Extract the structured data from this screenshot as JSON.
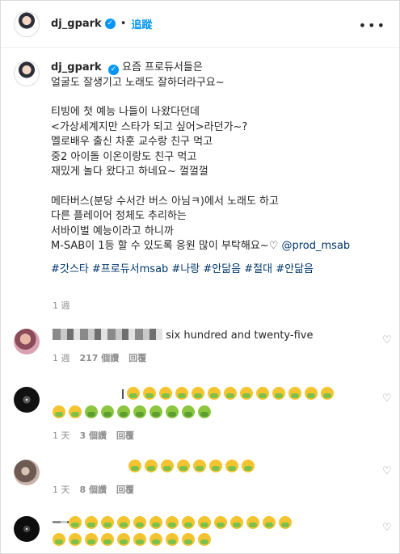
{
  "header": {
    "username": "dj_gpark",
    "follow_label": "追蹤",
    "more_label": "•••"
  },
  "caption": {
    "username": "dj_gpark",
    "lines": [
      "요즘 프로듀서들은",
      "얼굴도 잘생기고 노래도 잘하더라구요~",
      "",
      "티빙에 첫 예능 나들이 나왔다던데",
      "<가상세계지만 스타가 되고 싶어>라던가~?",
      "멜로배우 출신 차훈 교수랑 친구 먹고",
      "중2 아이돌 이온이랑도 친구 먹고",
      "재밌게 놀다 왔다고 하네요~ 껄껄껄",
      "",
      "메타버스(분당 수서간 버스 아님ㅋ)에서 노래도 하고",
      "다른 플레이어 정체도 추리하는",
      "서바이벌 예능이라고 하니까"
    ],
    "last_line_text": "M-SAB이 1등 할 수 있도록 응원 많이 부탁해요~♡ ",
    "mention": "@prod_msab",
    "hashtags": "#갓스타 #프로듀서msab #나랑 #안닮음 #절대 #안닮음",
    "time": "1 週"
  },
  "comments": [
    {
      "text": "six hundred and twenty-five",
      "time": "1 週",
      "likes": "217 個讚",
      "reply": "回覆"
    },
    {
      "time": "1 天",
      "likes": "3 個讚",
      "reply": "回覆"
    },
    {
      "time": "1 天",
      "likes": "8 個讚",
      "reply": "回覆"
    },
    {
      "time": "",
      "likes": "",
      "reply": ""
    }
  ],
  "icons": {
    "verified": "verified-badge-icon",
    "heart": "heart-outline-icon",
    "emoji": "nauseated-face-emoji"
  },
  "colors": {
    "link": "#0095f6",
    "hashtag": "#00376b",
    "muted": "#8e8e8e"
  }
}
